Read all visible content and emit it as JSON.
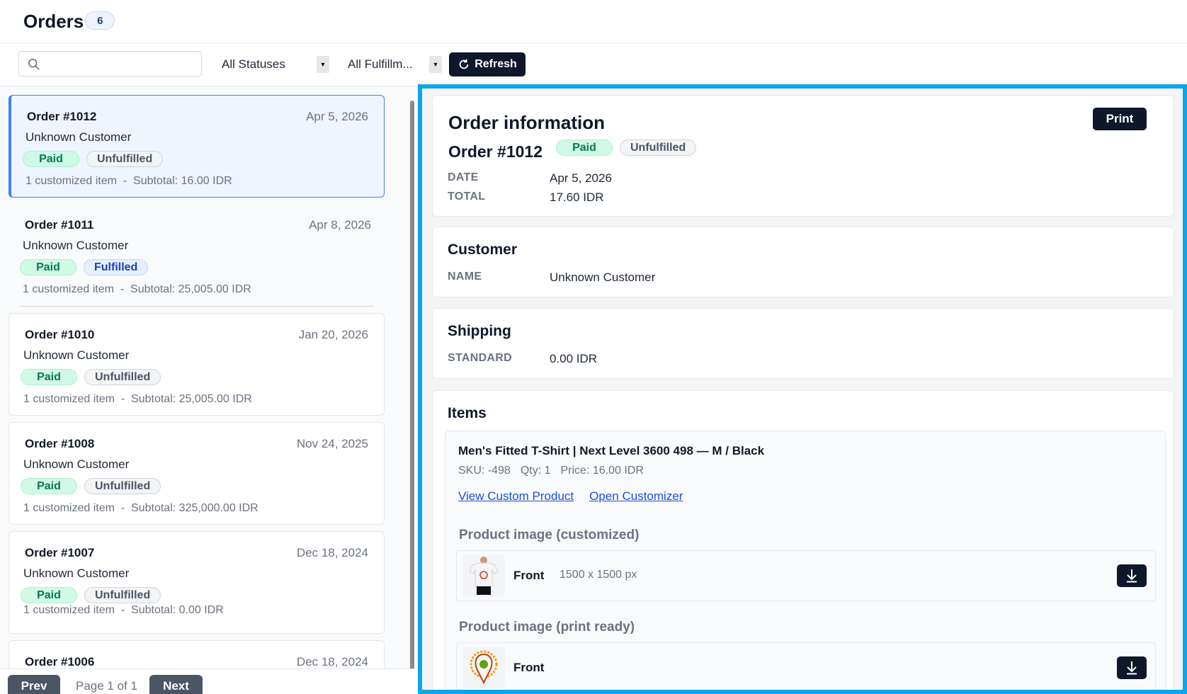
{
  "header": {
    "title": "Orders",
    "count": "6"
  },
  "filters": {
    "search_placeholder": "",
    "status_selected": "All Statuses",
    "fulfillment_selected": "All Fulfillm...",
    "refresh_label": "Refresh"
  },
  "orders": [
    {
      "number": "Order #1012",
      "date": "Apr 5, 2026",
      "customer": "Unknown Customer",
      "payment": "Paid",
      "fulfillment": "Unfulfilled",
      "summary": "1 customized item  -  Subtotal: 16.00 IDR"
    },
    {
      "number": "Order #1011",
      "date": "Apr 8, 2026",
      "customer": "Unknown Customer",
      "payment": "Paid",
      "fulfillment": "Fulfilled",
      "summary": "1 customized item  -  Subtotal: 25,005.00 IDR"
    },
    {
      "number": "Order #1010",
      "date": "Jan 20, 2026",
      "customer": "Unknown Customer",
      "payment": "Paid",
      "fulfillment": "Unfulfilled",
      "summary": "1 customized item  -  Subtotal: 25,005.00 IDR"
    },
    {
      "number": "Order #1008",
      "date": "Nov 24, 2025",
      "customer": "Unknown Customer",
      "payment": "Paid",
      "fulfillment": "Unfulfilled",
      "summary": "1 customized item  -  Subtotal: 325,000.00 IDR"
    },
    {
      "number": "Order #1007",
      "date": "Dec 18, 2024",
      "customer": "Unknown Customer",
      "payment": "Paid",
      "fulfillment": "Unfulfilled",
      "summary": "1 customized item  -  Subtotal: 0.00 IDR"
    },
    {
      "number": "Order #1006",
      "date": "Dec 18, 2024"
    }
  ],
  "pager": {
    "prev": "Prev",
    "label": "Page 1 of 1",
    "next": "Next"
  },
  "detail": {
    "title": "Order information",
    "print_label": "Print",
    "order_number": "Order #1012",
    "payment": "Paid",
    "fulfillment": "Unfulfilled",
    "date_key": "DATE",
    "date_value": "Apr 5, 2026",
    "total_key": "TOTAL",
    "total_value": "17.60 IDR",
    "customer_title": "Customer",
    "name_key": "NAME",
    "name_value": "Unknown Customer",
    "shipping_title": "Shipping",
    "shipping_key": "STANDARD",
    "shipping_value": "0.00 IDR",
    "items_title": "Items",
    "item": {
      "title": "Men's Fitted T-Shirt | Next Level 3600 498 — M / Black",
      "sku": "SKU: -498",
      "qty": "Qty: 1",
      "price": "Price: 16.00 IDR",
      "link_view": "View Custom Product",
      "link_open": "Open Customizer",
      "customized_heading": "Product image (customized)",
      "customized_label": "Front",
      "customized_size": "1500 x 1500 px",
      "print_heading": "Product image (print ready)",
      "print_label": "Front"
    }
  },
  "colors": {
    "accent": "#0ea5e9",
    "dark": "#0f172a",
    "paid_bg": "#d1fae5",
    "paid_fg": "#047857"
  }
}
